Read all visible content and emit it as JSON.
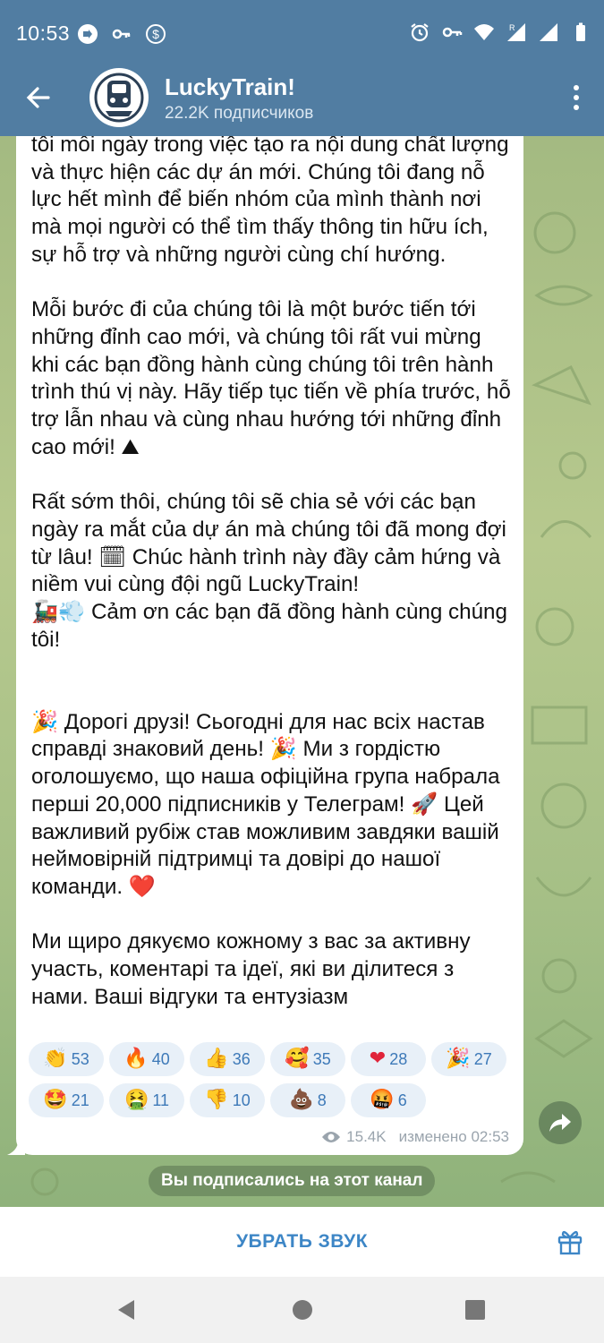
{
  "status_bar": {
    "time": "10:53",
    "left_icons": [
      "cast-icon",
      "key-icon",
      "dollar-icon"
    ],
    "right_icons": [
      "alarm-icon",
      "vpn-key-icon",
      "wifi-icon",
      "signal-icon",
      "signal-icon",
      "battery-icon"
    ]
  },
  "header": {
    "channel_name": "LuckyTrain!",
    "subscribers": "22.2K подписчиков",
    "brand_color": "#517da2"
  },
  "message": {
    "paragraphs_vi": [
      "tôi mỗi ngày trong việc tạo ra nội dung chất lượng và thực hiện các dự án mới. Chúng tôi đang nỗ lực hết mình để biến nhóm của mình thành nơi mà mọi người có thể tìm thấy thông tin hữu ích, sự hỗ trợ và những người cùng chí hướng.",
      "Mỗi bước đi của chúng tôi là một bước tiến tới những đỉnh cao mới, và chúng tôi rất vui mừng khi các bạn đồng hành cùng chúng tôi trên hành trình thú vị này. Hãy tiếp tục tiến về phía trước, hỗ trợ lẫn nhau và cùng nhau hướng tới những đỉnh cao mới! ⛰",
      "Rất sớm thôi, chúng tôi sẽ chia sẻ với các bạn ngày ra mắt của dự án mà chúng tôi đã mong đợi từ lâu! 🗓 Chúc hành trình này đầy cảm hứng và niềm vui cùng đội ngũ LuckyTrain!",
      "🚂💨 Cảm ơn các bạn đã đồng hành cùng chúng tôi!"
    ],
    "paragraphs_uk": [
      "🎉 Дорогі друзі! Сьогодні для нас всіх настав справді знаковий день! 🎉 Ми з гордістю оголошуємо, що наша офіційна група набрала перші 20,000 підписників у Телеграм! 🚀 Цей важливий рубіж став можливим завдяки вашій неймовірній підтримці та довірі до нашої команди. ❤️",
      "Ми щиро дякуємо кожному з вас за активну участь, коментарі та ідеї, які ви ділитеся з нами. Ваші відгуки та ентузіазм"
    ],
    "reactions": [
      {
        "emoji": "👏",
        "count": "53"
      },
      {
        "emoji": "🔥",
        "count": "40"
      },
      {
        "emoji": "👍",
        "count": "36"
      },
      {
        "emoji": "🥰",
        "count": "35"
      },
      {
        "emoji": "❤",
        "count": "28"
      },
      {
        "emoji": "🎉",
        "count": "27"
      },
      {
        "emoji": "🤩",
        "count": "21"
      },
      {
        "emoji": "🤮",
        "count": "11"
      },
      {
        "emoji": "👎",
        "count": "10"
      },
      {
        "emoji": "💩",
        "count": "8"
      },
      {
        "emoji": "🤬",
        "count": "6"
      }
    ],
    "views": "15.4K",
    "edited": "изменено 02:53"
  },
  "service_message": "Вы подписались на этот канал",
  "bottom": {
    "mute_label": "УБРАТЬ ЗВУК"
  },
  "icons": {
    "back": "back-arrow-icon",
    "menu": "more-vertical-icon",
    "share": "share-icon",
    "gift": "gift-icon",
    "views": "eye-icon"
  }
}
